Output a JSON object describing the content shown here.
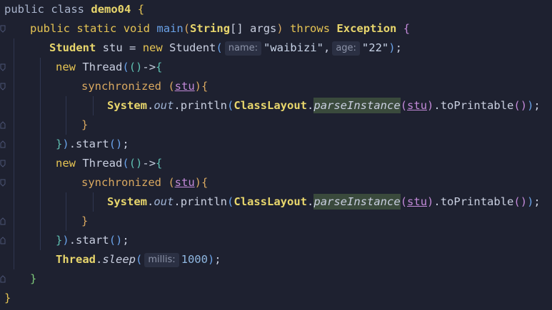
{
  "lines": {
    "l1": {
      "kw1": "public",
      "kw2": "class",
      "name": "demo04",
      "brace": "{"
    },
    "l2": {
      "kw1": "public",
      "kw2": "static",
      "kw3": "void",
      "method": "main",
      "p1": "(",
      "type": "String",
      "arr": "[]",
      "arg": "args",
      "p2": ")",
      "throws": "throws",
      "exc": "Exception",
      "brace": "{"
    },
    "l3": {
      "type": "Student",
      "var": "stu",
      "eq": "=",
      "new": "new",
      "ctor": "Student",
      "p1": "(",
      "hint1": "name:",
      "val1": "\"waibizi\"",
      "comma": ",",
      "hint2": "age:",
      "val2": "\"22\"",
      "p2": ")",
      "semi": ";"
    },
    "l4": {
      "new": "new",
      "cls": "Thread",
      "p1": "(",
      "p2": "(",
      "p3": ")",
      "arrow": "->",
      "brace": "{"
    },
    "l5": {
      "kw": "synchronized",
      "p1": "(",
      "var": "stu",
      "p2": ")",
      "brace": "{"
    },
    "l6": {
      "sys": "System",
      "dot1": ".",
      "out": "out",
      "dot2": ".",
      "println": "println",
      "p1": "(",
      "cl": "ClassLayout",
      "dot3": ".",
      "pi": "parseInstance",
      "p2": "(",
      "var": "stu",
      "p3": ")",
      "dot4": ".",
      "tp": "toPrintable",
      "p4": "(",
      "p5": ")",
      "p6": ")",
      "semi": ";"
    },
    "l7": {
      "brace": "}"
    },
    "l8": {
      "brace": "}",
      "p1": ")",
      "start": ".start",
      "p2": "(",
      "p3": ")",
      "semi": ";"
    },
    "l9": {
      "new": "new",
      "cls": "Thread",
      "p1": "(",
      "p2": "(",
      "p3": ")",
      "arrow": "->",
      "brace": "{"
    },
    "l10": {
      "kw": "synchronized",
      "p1": "(",
      "var": "stu",
      "p2": ")",
      "brace": "{"
    },
    "l11": {
      "sys": "System",
      "dot1": ".",
      "out": "out",
      "dot2": ".",
      "println": "println",
      "p1": "(",
      "cl": "ClassLayout",
      "dot3": ".",
      "pi": "parseInstance",
      "p2": "(",
      "var": "stu",
      "p3": ")",
      "dot4": ".",
      "tp": "toPrintable",
      "p4": "(",
      "p5": ")",
      "p6": ")",
      "semi": ";"
    },
    "l12": {
      "brace": "}"
    },
    "l13": {
      "brace": "}",
      "p1": ")",
      "start": ".start",
      "p2": "(",
      "p3": ")",
      "semi": ";"
    },
    "l14": {
      "cls": "Thread",
      "dot": ".",
      "sleep": "sleep",
      "p1": "(",
      "hint": "millis:",
      "val": "1000",
      "p2": ")",
      "semi": ";"
    },
    "l15": {
      "brace": "}"
    },
    "l16": {
      "brace": "}"
    }
  },
  "colors": {
    "background": "#1e2130",
    "keyword": "#e6c453",
    "hint_background": "#2b3043",
    "highlight": "#3a4a3c"
  }
}
